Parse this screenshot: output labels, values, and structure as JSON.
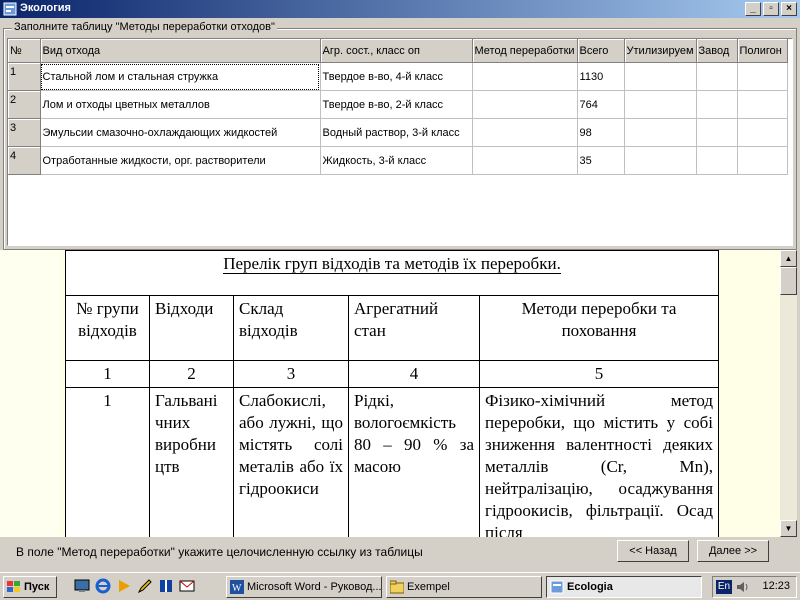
{
  "window": {
    "title": "Экология"
  },
  "form": {
    "group_title": "Заполните таблицу \"Методы переработки отходов\"",
    "columns": [
      "№",
      "Вид отхода",
      "Агр. сост., класс оп",
      "Метод переработки",
      "Всего",
      "Утилизируем",
      "Завод",
      "Полигон"
    ],
    "rows": [
      [
        "1",
        "Стальной лом и стальная стружка",
        "Твердое в-во, 4-й класс",
        "",
        "1130",
        "",
        "",
        ""
      ],
      [
        "2",
        "Лом и отходы цветных металлов",
        "Твердое в-во, 2-й класс",
        "",
        "764",
        "",
        "",
        ""
      ],
      [
        "3",
        "Эмульсии смазочно-охлаждающих жидкостей",
        "Водный раствор, 3-й класс",
        "",
        "98",
        "",
        "",
        ""
      ],
      [
        "4",
        "Отработанные жидкости, орг. растворители",
        "Жидкость, 3-й класс",
        "",
        "35",
        "",
        "",
        ""
      ]
    ]
  },
  "document": {
    "title": "Перелік груп відходів та методів їх переробки.",
    "headers": [
      "№ групи відходів",
      "Відходи",
      "Склад відходів",
      "Агрегатний стан",
      "Методи переробки та поховання"
    ],
    "numbers": [
      "1",
      "2",
      "3",
      "4",
      "5"
    ],
    "row1": {
      "num": "1",
      "waste": "Гальвані чних виробни цтв",
      "composition": "Слабокислі, або лужні, що містять солі металів або їх гідроокиси",
      "state": "Рідкі, вологоємкість 80 – 90 % за масою",
      "method": "Фізико-хімічний метод переробки, що містить у собі зниження валентності деяких металлів (Cr, Mn), нейтралізацію, осаджування гідроокисів, фільтрації. Осад після"
    }
  },
  "status": {
    "hint": "В поле \"Метод переработки\" укажите целочисленную ссылку из таблицы",
    "back_label": "<< Назад",
    "next_label": "Далее >>"
  },
  "taskbar": {
    "start_label": "Пуск",
    "tasks": [
      "Microsoft Word - Руковод...",
      "Exempel",
      "Ecologia"
    ],
    "lang": "En",
    "clock": "12:23"
  }
}
